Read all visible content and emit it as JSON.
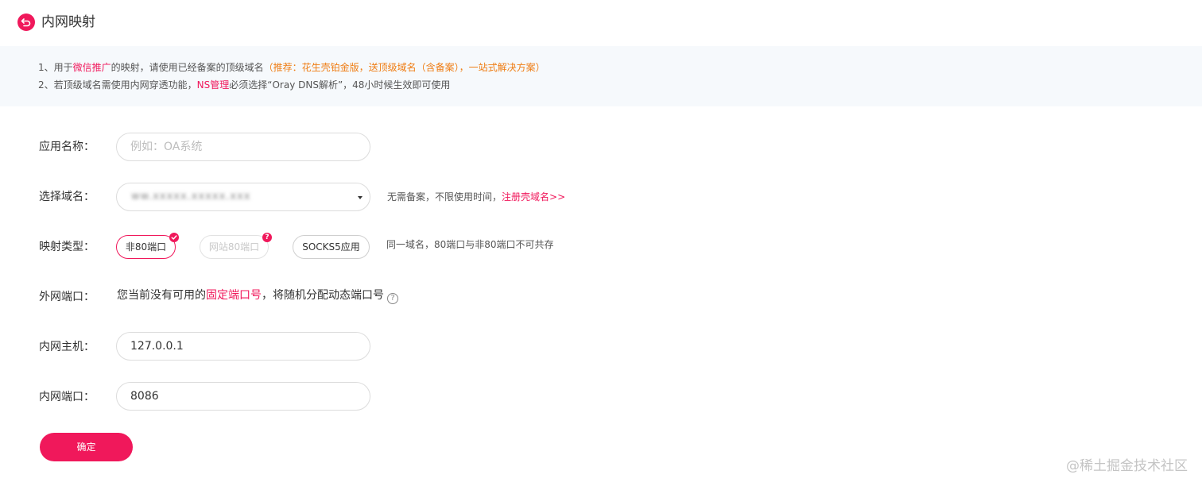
{
  "header": {
    "title": "内网映射"
  },
  "notice": {
    "line1": {
      "p1": "1、用于",
      "highlight": "微信推广",
      "p2": "的映射，请使用已经备案的顶级域名",
      "promo": "（推荐：花生壳铂金版，送顶级域名（含备案），一站式解决方案）"
    },
    "line2": {
      "p1": "2、若顶级域名需使用内网穿透功能，",
      "highlight": "NS管理",
      "p2": "必须选择“Oray DNS解析”，48小时候生效即可使用"
    }
  },
  "form": {
    "app_name": {
      "label": "应用名称：",
      "value": "",
      "placeholder": "例如：OA系统"
    },
    "domain": {
      "label": "选择域名：",
      "selected": "ww.xxxxx.xxxxx.xxx",
      "hint_text": "无需备案，不限使用时间，",
      "hint_link": "注册壳域名>>"
    },
    "mapping_type": {
      "label": "映射类型：",
      "options": [
        "非80端口",
        "网站80端口",
        "SOCKS5应用"
      ],
      "selected": "非80端口",
      "hint": "同一域名，80端口与非80端口不可共存"
    },
    "external_port": {
      "label": "外网端口：",
      "p1": "您当前没有可用的",
      "link": "固定端口号",
      "p2": "，将随机分配动态端口号",
      "help": "?"
    },
    "internal_host": {
      "label": "内网主机：",
      "value": "127.0.0.1"
    },
    "internal_port": {
      "label": "内网端口：",
      "value": "8086"
    },
    "submit_label": "确定"
  },
  "watermark": "@稀土掘金技术社区",
  "colors": {
    "accent": "#f0185b",
    "promo": "#ef7d14",
    "notice_bg": "#f6f9fc"
  },
  "icons": {
    "back": "back-arrow-icon",
    "dropdown": "caret-down-icon",
    "check": "check-badge-icon",
    "alert": "alert-badge-icon",
    "help": "help-icon"
  }
}
